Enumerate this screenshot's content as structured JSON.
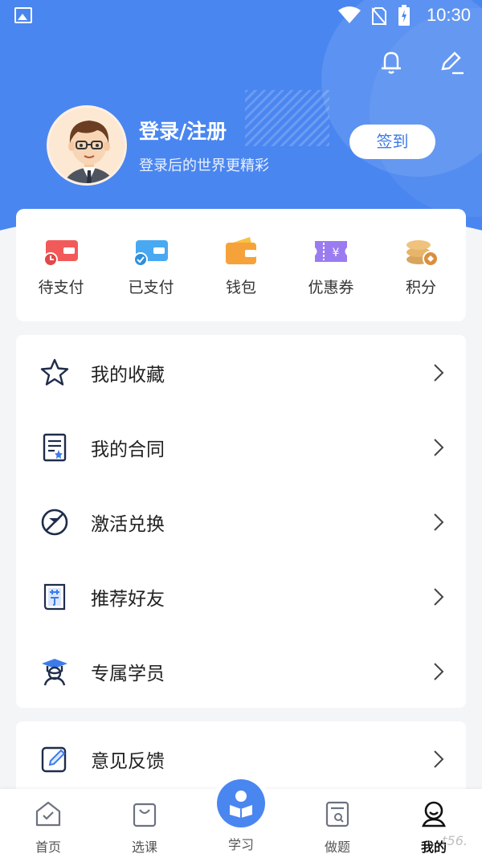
{
  "status_bar": {
    "time": "10:30",
    "icons": [
      "gallery-icon",
      "wifi-icon",
      "no-sim-icon",
      "battery-charging-icon"
    ]
  },
  "header": {
    "icons": [
      "bell-icon",
      "edit-icon"
    ],
    "login_title": "登录/注册",
    "login_subtitle": "登录后的世界更精彩",
    "signin_label": "签到"
  },
  "quick": [
    {
      "label": "待支付",
      "icon": "pending-payment-icon"
    },
    {
      "label": "已支付",
      "icon": "paid-icon"
    },
    {
      "label": "钱包",
      "icon": "wallet-icon"
    },
    {
      "label": "优惠券",
      "icon": "coupon-icon"
    },
    {
      "label": "积分",
      "icon": "points-icon"
    }
  ],
  "menu": [
    {
      "label": "我的收藏",
      "icon": "star-icon"
    },
    {
      "label": "我的合同",
      "icon": "contract-icon"
    },
    {
      "label": "激活兑换",
      "icon": "activate-icon"
    },
    {
      "label": "推荐好友",
      "icon": "recommend-icon"
    },
    {
      "label": "专属学员",
      "icon": "student-icon"
    }
  ],
  "menu2": [
    {
      "label": "意见反馈",
      "icon": "feedback-icon"
    }
  ],
  "tabs": [
    {
      "label": "首页",
      "icon": "home-icon"
    },
    {
      "label": "选课",
      "icon": "bag-icon"
    },
    {
      "label": "学习",
      "icon": "study-icon"
    },
    {
      "label": "做题",
      "icon": "quiz-icon"
    },
    {
      "label": "我的",
      "icon": "profile-icon"
    }
  ],
  "watermark": "t56.",
  "colors": {
    "primary": "#4a86f0",
    "background": "#f4f5f7",
    "card": "#ffffff"
  }
}
